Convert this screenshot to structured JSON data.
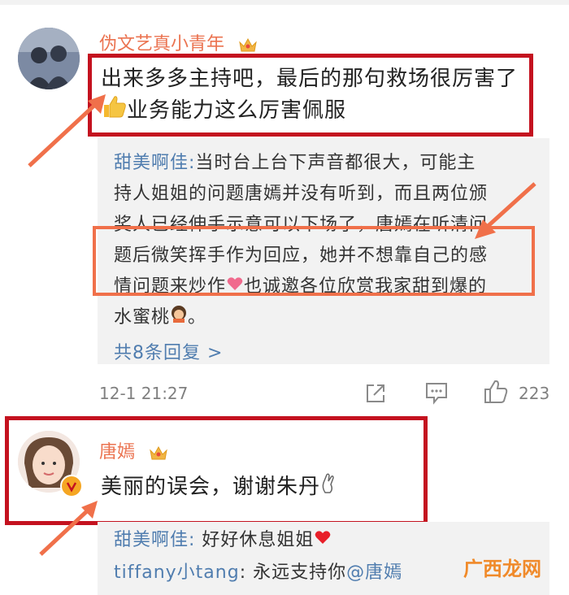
{
  "comment1": {
    "username": "伪文艺真小青年",
    "line1": "出来多多主持吧，最后的那句救场很厉害了",
    "line2": "业务能力这么厉害佩服"
  },
  "reply1": {
    "author": "甜美啊佳:",
    "line1": "当时台上台下声音都很大，可能主",
    "line2": "持人姐姐的问题唐嫣并没有听到，而且两位颁",
    "line3": "奖人已经伸手示意可以下场了，唐嫣在听清问",
    "line4": "题后微笑挥手作为回应，她并不想靠自己的感",
    "line5a": "情问题来炒作",
    "line5b": "也诚邀各位欣赏我家甜到爆的",
    "line6a": "水蜜桃",
    "line6b": "。",
    "more_replies": "共8条回复",
    "chevron": ">"
  },
  "meta": {
    "timestamp": "12-1 21:27",
    "likes": "223"
  },
  "comment2": {
    "username": "唐嫣",
    "text": "美丽的误会，谢谢朱丹"
  },
  "reply2": {
    "author1": "甜美啊佳:",
    "text1": "好好休息姐姐",
    "author2": "tiffany小tang",
    "colon": ":",
    "text2": "永远支持你",
    "mention": "@唐嫣"
  },
  "watermark": "广西龙网",
  "colors": {
    "username": "#eb7350",
    "link": "#507daf",
    "red_box": "#c4121f",
    "orange_box": "#f0704a"
  }
}
